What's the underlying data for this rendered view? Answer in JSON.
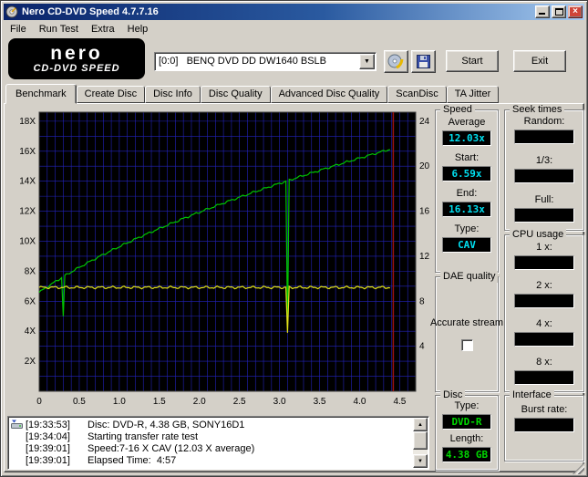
{
  "window": {
    "title": "Nero CD-DVD Speed 4.7.7.16"
  },
  "menu": {
    "items": [
      {
        "label": "File"
      },
      {
        "label": "Run Test"
      },
      {
        "label": "Extra"
      },
      {
        "label": "Help"
      }
    ]
  },
  "toolbar": {
    "logo_line1": "nero",
    "logo_line2": "CD-DVD SPEED",
    "drive_select": "[0:0]   BENQ DVD DD DW1640 BSLB",
    "start_label": "Start",
    "exit_label": "Exit"
  },
  "tabs": [
    {
      "label": "Benchmark",
      "selected": true
    },
    {
      "label": "Create Disc"
    },
    {
      "label": "Disc Info"
    },
    {
      "label": "Disc Quality"
    },
    {
      "label": "Advanced Disc Quality"
    },
    {
      "label": "ScanDisc"
    },
    {
      "label": "TA Jitter"
    }
  ],
  "colors": {
    "lcd_cyan": "#00dff0",
    "lcd_green": "#00d800"
  },
  "panels": {
    "speed": {
      "title": "Speed",
      "fields": [
        {
          "label": "Average",
          "value": "12.03x"
        },
        {
          "label": "Start:",
          "value": "6.59x"
        },
        {
          "label": "End:",
          "value": "16.13x"
        },
        {
          "label": "Type:",
          "value": "CAV"
        }
      ]
    },
    "seek": {
      "title": "Seek times",
      "fields": [
        {
          "label": "Random:",
          "value": ""
        },
        {
          "label": "1/3:",
          "value": ""
        },
        {
          "label": "Full:",
          "value": ""
        }
      ]
    },
    "dae": {
      "title": "DAE quality",
      "checkbox_label": "Accurate stream",
      "checked": false
    },
    "cpu": {
      "title": "CPU usage",
      "fields": [
        {
          "label": "1 x:",
          "value": ""
        },
        {
          "label": "2 x:",
          "value": ""
        },
        {
          "label": "4 x:",
          "value": ""
        },
        {
          "label": "8 x:",
          "value": ""
        }
      ]
    },
    "disc": {
      "title": "Disc",
      "fields": [
        {
          "label": "Type:",
          "value": "DVD-R"
        },
        {
          "label": "Length:",
          "value": "4.38 GB"
        }
      ]
    },
    "interface": {
      "title": "Interface",
      "fields": [
        {
          "label": "Burst rate:",
          "value": ""
        }
      ]
    }
  },
  "log": {
    "rows": [
      {
        "time": "[19:33:53]",
        "text": "Disc: DVD-R, 4.38 GB, SONY16D1"
      },
      {
        "time": "[19:34:04]",
        "text": "Starting transfer rate test"
      },
      {
        "time": "[19:39:01]",
        "text": "Speed:7-16 X CAV (12.03 X average)"
      },
      {
        "time": "[19:39:01]",
        "text": "Elapsed Time:  4:57"
      }
    ]
  },
  "chart_data": {
    "type": "line",
    "title": "",
    "xlim": [
      0,
      4.7
    ],
    "ylim": [
      0,
      18.6
    ],
    "x_ticks": [
      {
        "label": "0",
        "value": 0
      },
      {
        "label": "0.5",
        "value": 0.5
      },
      {
        "label": "1.0",
        "value": 1.0
      },
      {
        "label": "1.5",
        "value": 1.5
      },
      {
        "label": "2.0",
        "value": 2.0
      },
      {
        "label": "2.5",
        "value": 2.5
      },
      {
        "label": "3.0",
        "value": 3.0
      },
      {
        "label": "3.5",
        "value": 3.5
      },
      {
        "label": "4.0",
        "value": 4.0
      },
      {
        "label": "4.5",
        "value": 4.5
      }
    ],
    "y_left_ticks": [
      {
        "label": "18X",
        "value": 18
      },
      {
        "label": "16X",
        "value": 16
      },
      {
        "label": "14X",
        "value": 14
      },
      {
        "label": "12X",
        "value": 12
      },
      {
        "label": "10X",
        "value": 10
      },
      {
        "label": "8X",
        "value": 8
      },
      {
        "label": "6X",
        "value": 6
      },
      {
        "label": "4X",
        "value": 4
      },
      {
        "label": "2X",
        "value": 2
      }
    ],
    "y_right_ticks": [
      {
        "label": "24",
        "value": 18
      },
      {
        "label": "20",
        "value": 15
      },
      {
        "label": "16",
        "value": 12
      },
      {
        "label": "12",
        "value": 9
      },
      {
        "label": "8",
        "value": 6
      },
      {
        "label": "4",
        "value": 3
      }
    ],
    "grid": {
      "x_step": 0.1,
      "y_step": 1
    },
    "colors": {
      "plot_bg": "#000000",
      "grid": "#2323bc",
      "cursor": "#9b1313"
    },
    "series": [
      {
        "name": "read-speed-curve",
        "color": "#00c400",
        "model": "cav",
        "start": 6.59,
        "end": 16.13,
        "capacity": 4.38,
        "x_end": 4.38,
        "noise": 0.05,
        "dips": [
          {
            "x": 0.3,
            "v": 5.0
          },
          {
            "x": 3.1,
            "v": 4.5
          }
        ]
      },
      {
        "name": "rotation-speed-line",
        "color": "#e3e31a",
        "model": "flat",
        "value": 6.92,
        "x_end": 4.38,
        "noise": 0.06,
        "dips": [
          {
            "x": 3.1,
            "v": 3.9
          }
        ]
      }
    ],
    "cursor_line": {
      "x": 4.42
    }
  }
}
